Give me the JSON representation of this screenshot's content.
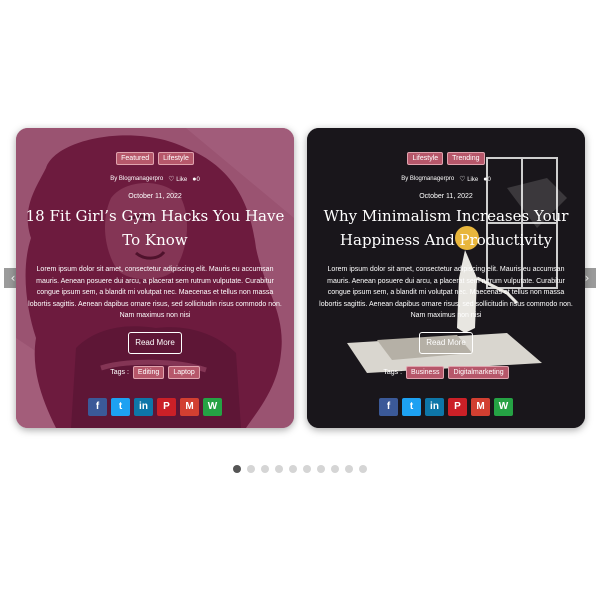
{
  "nav": {
    "prev_icon": "‹",
    "next_icon": "›"
  },
  "posts": [
    {
      "categories": [
        "Featured",
        "Lifestyle"
      ],
      "author": "By Blogmanagerpro",
      "like_label": "Like",
      "comments": "0",
      "date": "October 11, 2022",
      "title": "18 Fit Girl’s Gym Hacks You Have To Know",
      "excerpt": "Lorem ipsum dolor sit amet, consectetur adipiscing elit. Mauris eu accumsan mauris. Aenean posuere dui arcu, a placerat sem rutrum vulputate. Curabitur congue ipsum sem, a blandit mi volutpat nec. Maecenas et tellus non massa lobortis sagittis. Aenean dapibus ornare risus, sed sollicitudin risus commodo non. Nam maximus non nisi",
      "read_more": "Read More",
      "tags_label": "Tags :",
      "tags": [
        "Editing",
        "Laptop"
      ]
    },
    {
      "categories": [
        "Lifestyle",
        "Trending"
      ],
      "author": "By Blogmanagerpro",
      "like_label": "Like",
      "comments": "0",
      "date": "October 11, 2022",
      "title": "Why Minimalism Increases Your Happiness And Productivity",
      "excerpt": "Lorem ipsum dolor sit amet, consectetur adipiscing elit. Mauris eu accumsan mauris. Aenean posuere dui arcu, a placerat sem rutrum vulputate. Curabitur congue ipsum sem, a blandit mi volutpat nec. Maecenas et tellus non massa lobortis sagittis. Aenean dapibus ornare risus, sed sollicitudin risus commodo non. Nam maximus non nisi",
      "read_more": "Read More",
      "tags_label": "Tags :",
      "tags": [
        "Business",
        "Digitalmarketing"
      ]
    }
  ],
  "share": {
    "facebook": "f",
    "twitter": "t",
    "linkedin": "in",
    "pinterest": "P",
    "gmail": "M",
    "whatsapp": "W"
  },
  "pagination": {
    "total": 10,
    "active_index": 0
  },
  "colors": {
    "badge": "#b6576a",
    "card1_bg": "#a25a79",
    "card2_bg": "#17141a"
  }
}
